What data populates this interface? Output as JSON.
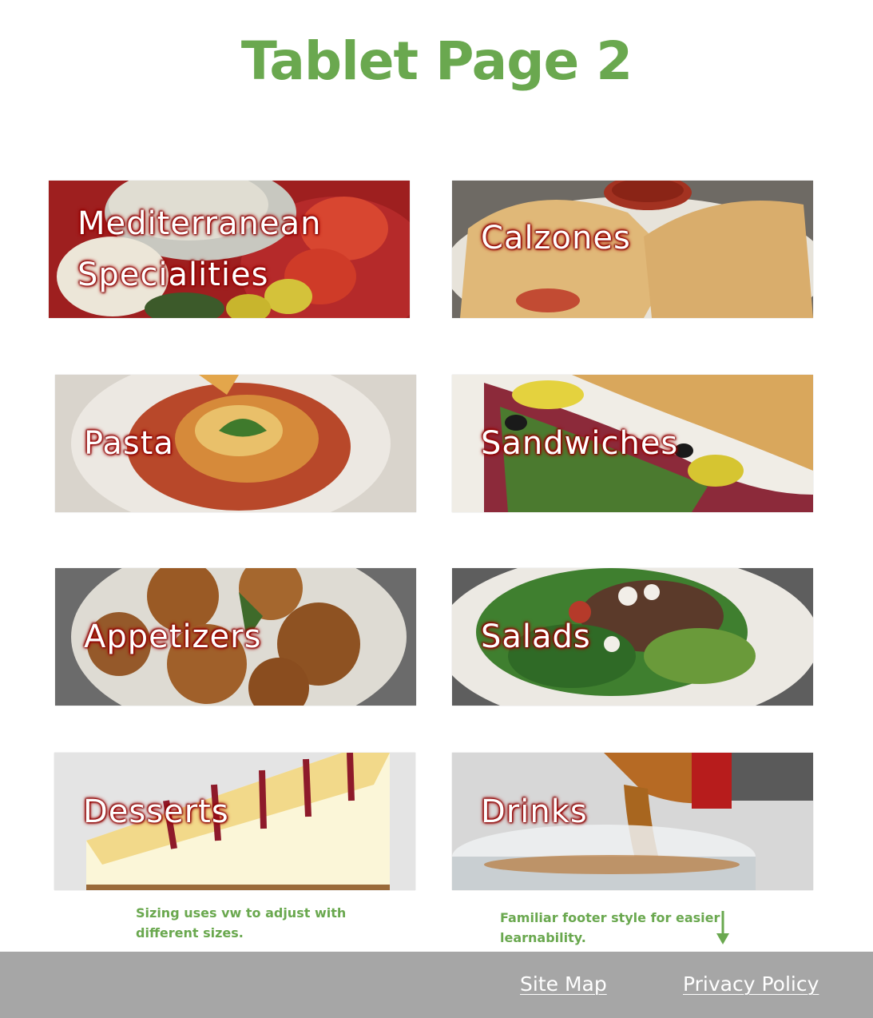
{
  "page": {
    "title": "Tablet Page 2"
  },
  "tiles": [
    {
      "label": "Mediterranean\nSpecialities",
      "icon": "mediterranean-plate-photo"
    },
    {
      "label": "Calzones",
      "icon": "calzone-photo"
    },
    {
      "label": "Pasta",
      "icon": "pasta-plate-photo"
    },
    {
      "label": "Sandwiches",
      "icon": "sandwich-photo"
    },
    {
      "label": "Appetizers",
      "icon": "appetizers-photo"
    },
    {
      "label": "Salads",
      "icon": "salad-photo"
    },
    {
      "label": "Desserts",
      "icon": "cheesecake-photo"
    },
    {
      "label": "Drinks",
      "icon": "drink-pour-photo"
    }
  ],
  "notes": {
    "sizing": "Sizing uses vw to adjust with\ndifferent sizes.",
    "footer": "Familiar footer style for easier\nlearnability."
  },
  "footer": {
    "site_map": "Site Map",
    "privacy_policy": "Privacy Policy"
  },
  "colors": {
    "accent_green": "#6aa84f",
    "footer_gray": "#a6a6a6",
    "label_glow": "#a80000"
  }
}
